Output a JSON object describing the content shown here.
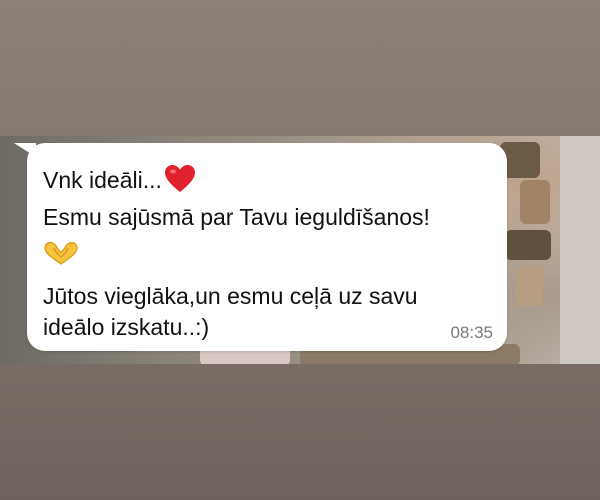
{
  "message": {
    "line1": "Vnk ideāli...",
    "line2": "Esmu sajūsmā par Tavu ieguldīšanos!",
    "line4": "Jūtos vieglāka,un esmu ceļā uz savu",
    "line5": "ideālo izskatu..:)",
    "time": "08:35",
    "icons": [
      "red-heart-icon",
      "heart-hands-icon"
    ],
    "colors": {
      "bubble": "#ffffff",
      "heart": "#e0212e",
      "hands": "#f6c33c",
      "timestamp": "#7a7a7a"
    }
  }
}
